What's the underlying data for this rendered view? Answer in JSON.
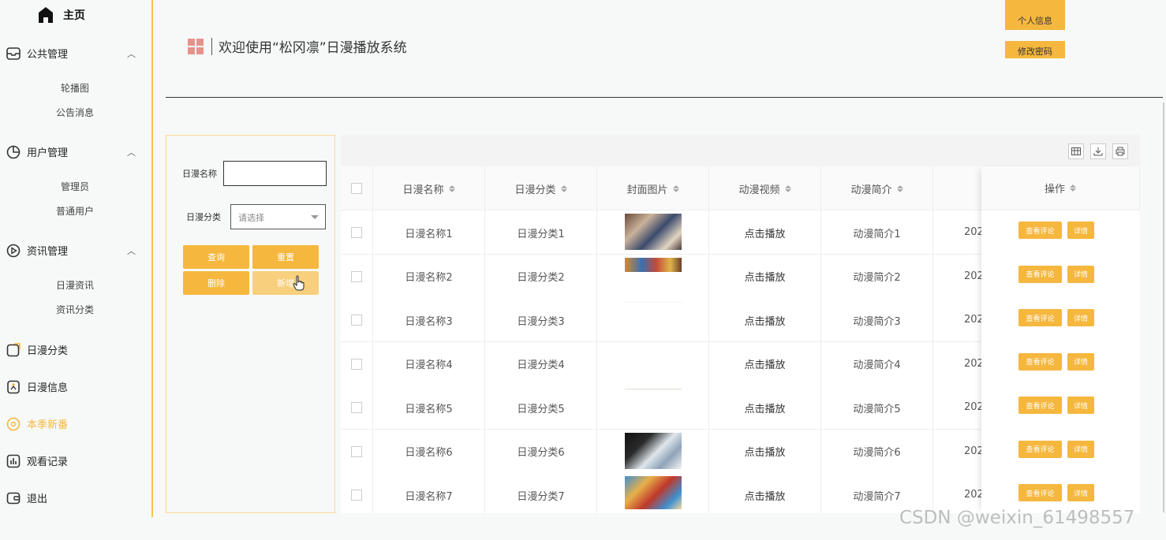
{
  "sidebar": {
    "home": "主页",
    "groups": [
      {
        "label": "公共管理",
        "icon": "inbox-icon",
        "items": [
          "轮播图",
          "公告消息"
        ]
      },
      {
        "label": "用户管理",
        "icon": "pie-chart-icon",
        "items": [
          "管理员",
          "普通用户"
        ]
      },
      {
        "label": "资讯管理",
        "icon": "play-circle-icon",
        "items": [
          "日漫资讯",
          "资讯分类"
        ]
      }
    ],
    "singles": [
      {
        "label": "日漫分类",
        "icon": "edit-icon"
      },
      {
        "label": "日漫信息",
        "icon": "bookmark-icon"
      },
      {
        "label": "本季新番",
        "icon": "sun-icon"
      },
      {
        "label": "观看记录",
        "icon": "bar-chart-icon"
      },
      {
        "label": "退出",
        "icon": "wallet-icon"
      }
    ],
    "active_color": "#f5b73e"
  },
  "header": {
    "title": "欢迎使用“松冈凛”日漫播放系统",
    "user_menu": [
      "个人信息",
      "修改密码"
    ]
  },
  "search": {
    "name_label": "日漫名称",
    "name_value": "",
    "category_label": "日漫分类",
    "category_placeholder": "请选择",
    "buttons": {
      "query": "查询",
      "reset": "重置",
      "delete": "删除",
      "add": "新增"
    }
  },
  "table": {
    "columns": [
      "日漫名称",
      "日漫分类",
      "封面图片",
      "动漫视频",
      "动漫简介",
      "操作"
    ],
    "rows": [
      {
        "name": "日漫名称1",
        "category": "日漫分类1",
        "video": "点击播放",
        "intro": "动漫简介1",
        "year": "202"
      },
      {
        "name": "日漫名称2",
        "category": "日漫分类2",
        "video": "点击播放",
        "intro": "动漫简介2",
        "year": "202"
      },
      {
        "name": "日漫名称3",
        "category": "日漫分类3",
        "video": "点击播放",
        "intro": "动漫简介3",
        "year": "202"
      },
      {
        "name": "日漫名称4",
        "category": "日漫分类4",
        "video": "点击播放",
        "intro": "动漫简介4",
        "year": "202"
      },
      {
        "name": "日漫名称5",
        "category": "日漫分类5",
        "video": "点击播放",
        "intro": "动漫简介5",
        "year": "202"
      },
      {
        "name": "日漫名称6",
        "category": "日漫分类6",
        "video": "点击播放",
        "intro": "动漫简介6",
        "year": "202"
      },
      {
        "name": "日漫名称7",
        "category": "日漫分类7",
        "video": "点击播放",
        "intro": "动漫简介7",
        "year": "202"
      }
    ],
    "row_actions": {
      "comments": "查看评论",
      "details": "详情"
    },
    "toolbar_icons": [
      "columns-icon",
      "export-icon",
      "print-icon"
    ]
  },
  "watermark": "CSDN @weixin_61498557",
  "colors": {
    "accent": "#f5b73e",
    "accent_light": "#f8cf7c",
    "title_icon": "#e9928c"
  }
}
